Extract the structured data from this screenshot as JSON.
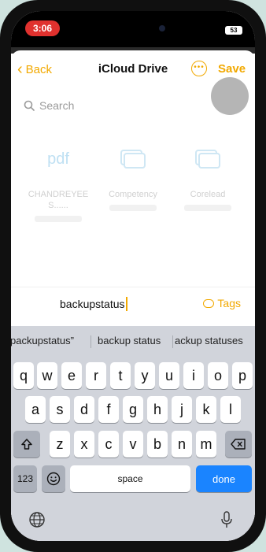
{
  "status_bar": {
    "time": "3:06",
    "battery": "53"
  },
  "nav": {
    "back_label": "Back",
    "title": "iCloud Drive",
    "more_glyph": "•••",
    "save_label": "Save"
  },
  "search": {
    "placeholder": "Search"
  },
  "files": [
    {
      "icon": "pdf-icon",
      "icon_text": "pdf",
      "name": "CHANDREYEE S......"
    },
    {
      "icon": "folder-icon",
      "name": "Competency"
    },
    {
      "icon": "folder-icon",
      "name": "Corelead"
    }
  ],
  "rename": {
    "value": "backupstatus",
    "tags_label": "Tags"
  },
  "keyboard": {
    "suggestions": [
      "packupstatus”",
      "backup status",
      "ackup statuses"
    ],
    "row1": [
      "q",
      "w",
      "e",
      "r",
      "t",
      "y",
      "u",
      "i",
      "o",
      "p"
    ],
    "row2": [
      "a",
      "s",
      "d",
      "f",
      "g",
      "h",
      "j",
      "k",
      "l"
    ],
    "row3": [
      "z",
      "x",
      "c",
      "v",
      "b",
      "n",
      "m"
    ],
    "numbers_label": "123",
    "space_label": "space",
    "done_label": "done"
  },
  "colors": {
    "accent": "#f2a900",
    "done_blue": "#1a84ff",
    "recording": "#e0312e"
  }
}
